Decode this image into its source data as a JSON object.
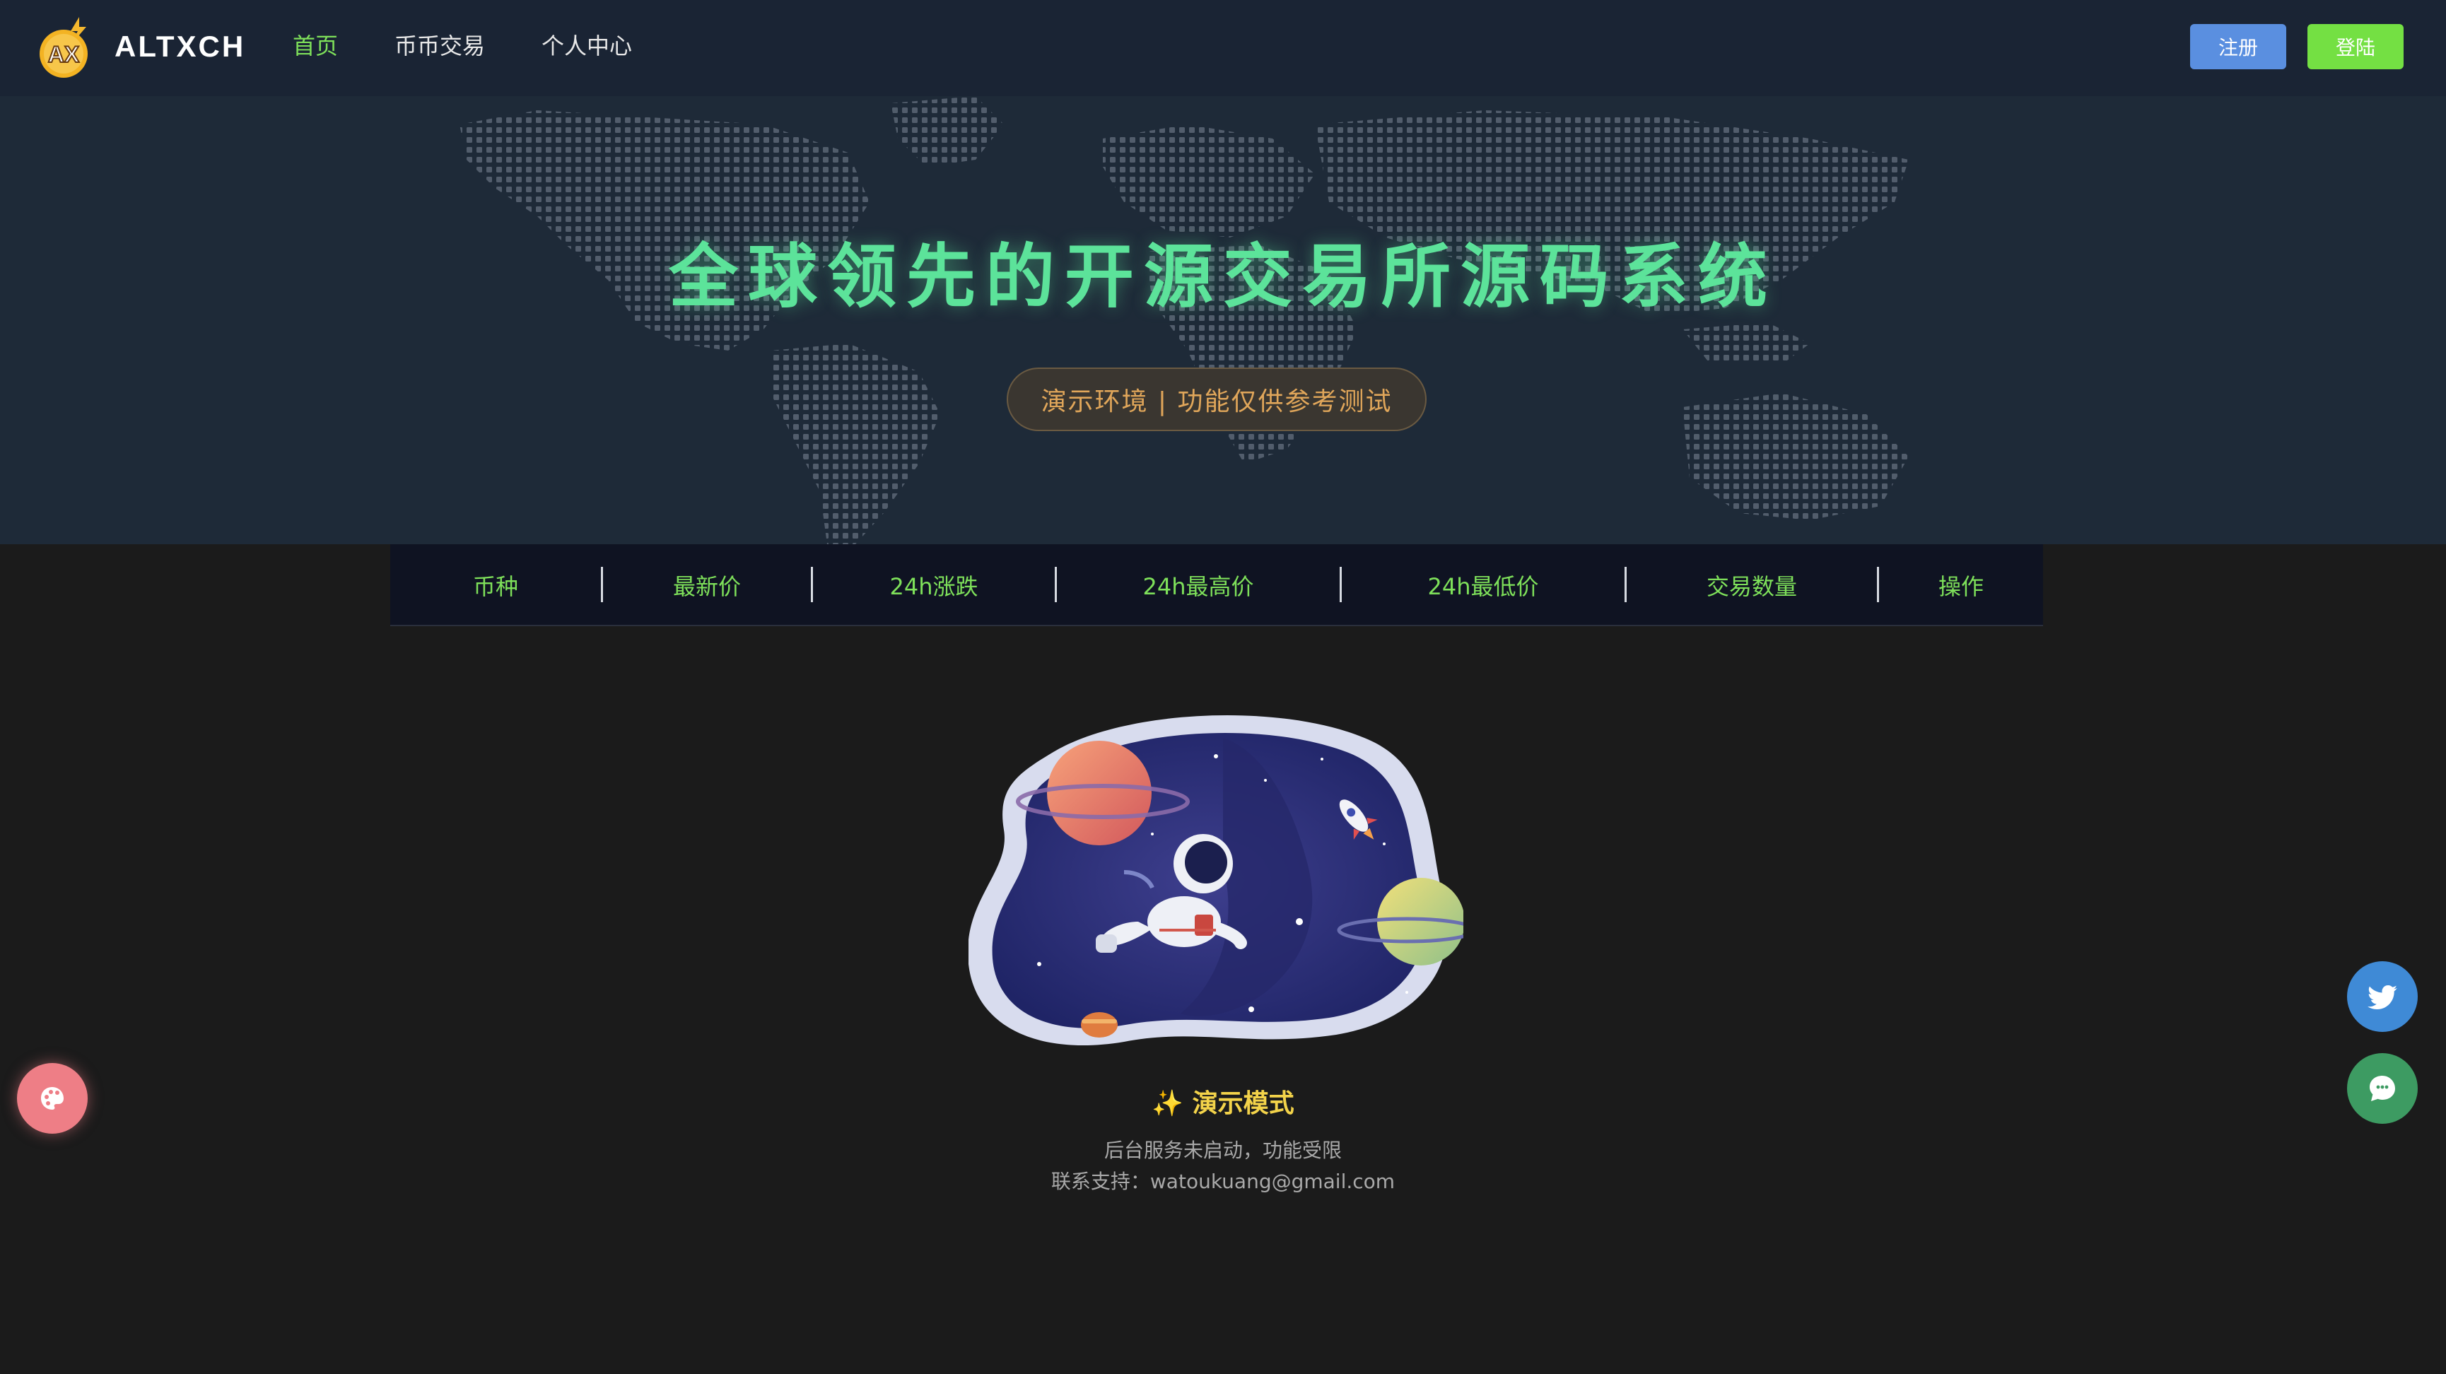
{
  "header": {
    "logo_text": "AX",
    "brand": "ALTXCH",
    "nav": [
      "首页",
      "币币交易",
      "个人中心"
    ],
    "active_nav": "首页",
    "register_label": "注册",
    "login_label": "登陆"
  },
  "hero": {
    "title": "全球领先的开源交易所源码系统",
    "notice": "演示环境 | 功能仅供参考测试"
  },
  "market_table": {
    "columns": [
      "币种",
      "最新价",
      "24h涨跌",
      "24h最高价",
      "24h最低价",
      "交易数量",
      "操作"
    ],
    "rows": []
  },
  "empty_state": {
    "title": "✨ 演示模式",
    "message": "后台服务未启动，功能受限",
    "contact": "联系支持：watoukuang@gmail.com"
  },
  "colors": {
    "accent_green": "#7ee05a",
    "title_green": "#5ce39a",
    "register_blue": "#5a8fe0",
    "login_green": "#74e043",
    "demo_yellow": "#f3d34a"
  },
  "icons": {
    "theme": "palette-icon",
    "twitter": "twitter-icon",
    "chat": "chat-icon"
  }
}
